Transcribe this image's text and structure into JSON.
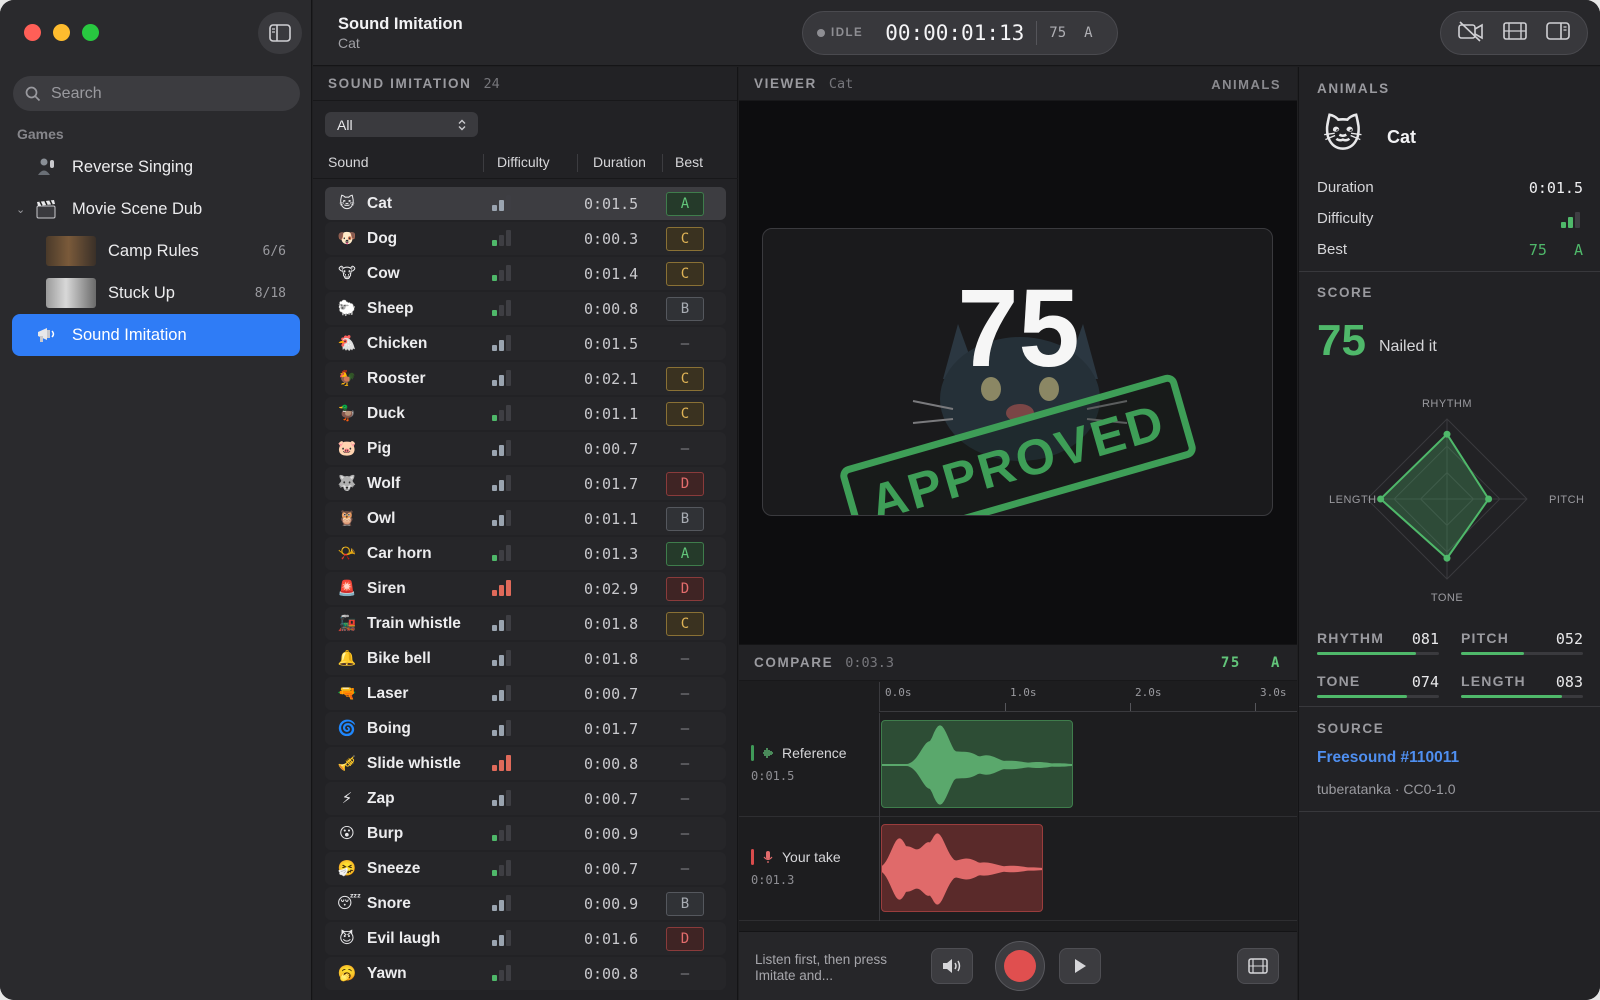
{
  "sidebar": {
    "search_placeholder": "Search",
    "section": "Games",
    "items": [
      {
        "label": "Reverse Singing",
        "icon": "microphone-person-icon"
      },
      {
        "label": "Movie Scene Dub",
        "icon": "clapperboard-icon",
        "expanded": true
      },
      {
        "label": "Camp Rules",
        "count": "6/6",
        "icon": "thumbnail"
      },
      {
        "label": "Stuck Up",
        "count": "8/18",
        "icon": "thumbnail"
      },
      {
        "label": "Sound Imitation",
        "icon": "megaphone-icon",
        "active": true
      }
    ]
  },
  "header": {
    "title": "Sound Imitation",
    "subtitle": "Cat",
    "status": "IDLE",
    "timecode": "00:00:01:13",
    "score": "75",
    "grade": "A"
  },
  "list": {
    "title": "SOUND IMITATION",
    "count": "24",
    "filter": "All",
    "columns": {
      "sound": "Sound",
      "difficulty": "Difficulty",
      "duration": "Duration",
      "best": "Best"
    },
    "rows": [
      {
        "emoji": "🐱",
        "name": "Cat",
        "difficulty": 2,
        "duration": "0:01.5",
        "best": "A",
        "selected": true
      },
      {
        "emoji": "🐶",
        "name": "Dog",
        "difficulty": 1,
        "duration": "0:00.3",
        "best": "C"
      },
      {
        "emoji": "🐮",
        "name": "Cow",
        "difficulty": 1,
        "duration": "0:01.4",
        "best": "C"
      },
      {
        "emoji": "🐑",
        "name": "Sheep",
        "difficulty": 1,
        "duration": "0:00.8",
        "best": "B"
      },
      {
        "emoji": "🐔",
        "name": "Chicken",
        "difficulty": 2,
        "duration": "0:01.5",
        "best": "—"
      },
      {
        "emoji": "🐓",
        "name": "Rooster",
        "difficulty": 2,
        "duration": "0:02.1",
        "best": "C"
      },
      {
        "emoji": "🦆",
        "name": "Duck",
        "difficulty": 1,
        "duration": "0:01.1",
        "best": "C"
      },
      {
        "emoji": "🐷",
        "name": "Pig",
        "difficulty": 2,
        "duration": "0:00.7",
        "best": "—"
      },
      {
        "emoji": "🐺",
        "name": "Wolf",
        "difficulty": 2,
        "duration": "0:01.7",
        "best": "D"
      },
      {
        "emoji": "🦉",
        "name": "Owl",
        "difficulty": 2,
        "duration": "0:01.1",
        "best": "B"
      },
      {
        "emoji": "📯",
        "name": "Car horn",
        "difficulty": 1,
        "duration": "0:01.3",
        "best": "A"
      },
      {
        "emoji": "🚨",
        "name": "Siren",
        "difficulty": 3,
        "duration": "0:02.9",
        "best": "D"
      },
      {
        "emoji": "🚂",
        "name": "Train whistle",
        "difficulty": 2,
        "duration": "0:01.8",
        "best": "C"
      },
      {
        "emoji": "🔔",
        "name": "Bike bell",
        "difficulty": 2,
        "duration": "0:01.8",
        "best": "—"
      },
      {
        "emoji": "🔫",
        "name": "Laser",
        "difficulty": 2,
        "duration": "0:00.7",
        "best": "—"
      },
      {
        "emoji": "🌀",
        "name": "Boing",
        "difficulty": 2,
        "duration": "0:01.7",
        "best": "—"
      },
      {
        "emoji": "🎺",
        "name": "Slide whistle",
        "difficulty": 3,
        "duration": "0:00.8",
        "best": "—"
      },
      {
        "emoji": "⚡",
        "name": "Zap",
        "difficulty": 2,
        "duration": "0:00.7",
        "best": "—"
      },
      {
        "emoji": "😮",
        "name": "Burp",
        "difficulty": 1,
        "duration": "0:00.9",
        "best": "—"
      },
      {
        "emoji": "🤧",
        "name": "Sneeze",
        "difficulty": 1,
        "duration": "0:00.7",
        "best": "—"
      },
      {
        "emoji": "😴",
        "name": "Snore",
        "difficulty": 2,
        "duration": "0:00.9",
        "best": "B"
      },
      {
        "emoji": "😈",
        "name": "Evil laugh",
        "difficulty": 2,
        "duration": "0:01.6",
        "best": "D"
      },
      {
        "emoji": "🥱",
        "name": "Yawn",
        "difficulty": 1,
        "duration": "0:00.8",
        "best": "—"
      }
    ]
  },
  "viewer": {
    "title": "VIEWER",
    "subtitle": "Cat",
    "category": "ANIMALS",
    "score": "75",
    "stamp": "APPROVED"
  },
  "compare": {
    "title": "COMPARE",
    "duration": "0:03.3",
    "score": "75",
    "grade": "A",
    "ruler": [
      "0.0s",
      "1.0s",
      "2.0s",
      "3.0s"
    ],
    "tracks": [
      {
        "label": "Reference",
        "time": "0:01.5",
        "color": "#3f9a58"
      },
      {
        "label": "Your take",
        "time": "0:01.3",
        "color": "#d94c4c"
      }
    ],
    "hint": "Listen first, then press Imitate and..."
  },
  "inspector": {
    "category": "ANIMALS",
    "name": "Cat",
    "emoji": "🐱",
    "duration_label": "Duration",
    "duration": "0:01.5",
    "difficulty_label": "Difficulty",
    "difficulty": 2,
    "best_label": "Best",
    "best_score": "75",
    "best_grade": "A",
    "score_title": "SCORE",
    "score": "75",
    "verdict": "Nailed it",
    "radar_labels": {
      "top": "RHYTHM",
      "right": "PITCH",
      "bottom": "TONE",
      "left": "LENGTH"
    },
    "metrics": [
      {
        "name": "RHYTHM",
        "value": "081",
        "fraction": 0.81
      },
      {
        "name": "PITCH",
        "value": "052",
        "fraction": 0.52
      },
      {
        "name": "TONE",
        "value": "074",
        "fraction": 0.74
      },
      {
        "name": "LENGTH",
        "value": "083",
        "fraction": 0.83
      }
    ],
    "source_title": "SOURCE",
    "source_link": "Freesound #110011",
    "source_credit": "tuberatanka · CC0-1.0"
  },
  "colors": {
    "accent": "#2f7cf6",
    "good": "#4fb86a",
    "record": "#e04f4f"
  }
}
